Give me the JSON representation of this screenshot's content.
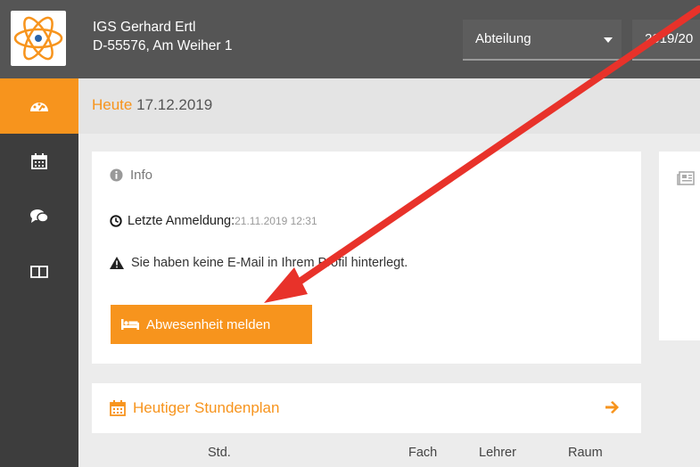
{
  "header": {
    "school_name": "IGS Gerhard Ertl",
    "school_address": "D-55576, Am Weiher 1",
    "department_label": "Abteilung",
    "school_year_partial": "2019/20"
  },
  "sidebar": {
    "items": [
      {
        "icon": "dashboard-icon",
        "active": true
      },
      {
        "icon": "calendar-icon",
        "active": false
      },
      {
        "icon": "chat-icon",
        "active": false
      },
      {
        "icon": "book-icon",
        "active": false
      }
    ]
  },
  "datebar": {
    "today_label": "Heute",
    "date": "17.12.2019"
  },
  "info": {
    "title": "Info",
    "last_login_label": "Letzte Anmeldung:",
    "last_login_value": "21.11.2019 12:31",
    "email_warning": "Sie haben keine E-Mail in Ihrem Profil hinterlegt.",
    "absence_button": "Abwesenheit melden"
  },
  "timetable": {
    "title": "Heutiger Stundenplan",
    "columns": [
      "Std.",
      "Fach",
      "Lehrer",
      "Raum"
    ]
  },
  "colors": {
    "accent": "#f7941d",
    "topbar": "#555555",
    "sidebar": "#3d3d3d",
    "annotation_arrow": "#e8322a"
  }
}
